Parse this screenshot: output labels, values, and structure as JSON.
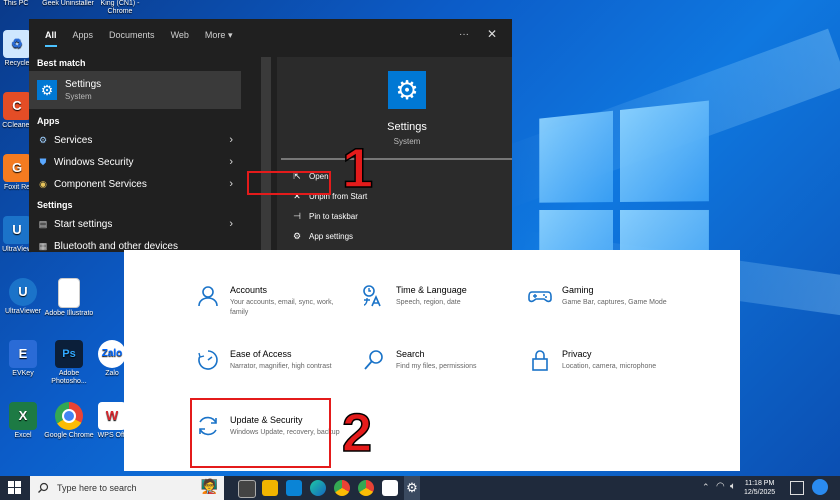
{
  "desktop": {
    "top_labels": [
      "This PC",
      "Geek Uninstaller",
      "King (CN1) - Chrome"
    ],
    "icons": [
      {
        "label": "Recycle",
        "color": "#9ad0ff",
        "glyph": "♻"
      },
      {
        "label": "CCleaner",
        "color": "#e44d26",
        "glyph": "C"
      },
      {
        "label": "Foxit Re",
        "color": "#f47b20",
        "glyph": "G"
      },
      {
        "label": "UltraView",
        "color": "#1b73c9",
        "glyph": "U"
      },
      {
        "label": "UltraViewer",
        "color": "#1b73c9",
        "glyph": "U"
      },
      {
        "label": "Adobe Illustrato",
        "color": "#ffffff",
        "glyph": ""
      },
      {
        "label": "EVKey",
        "color": "#2a6bd6",
        "glyph": "E"
      },
      {
        "label": "Adobe Photosho...",
        "color": "#0b1f3a",
        "glyph": "Ps"
      },
      {
        "label": "Zalo",
        "color": "#ffffff",
        "glyph": "Z"
      },
      {
        "label": "Excel",
        "color": "#1d7a44",
        "glyph": "X"
      },
      {
        "label": "Google Chrome",
        "color": "#ffffff",
        "glyph": ""
      },
      {
        "label": "WPS Offi",
        "color": "#ffffff",
        "glyph": "W"
      }
    ]
  },
  "start_menu": {
    "tabs": [
      "All",
      "Apps",
      "Documents",
      "Web",
      "More"
    ],
    "dots": "···",
    "close": "✕",
    "best_match_label": "Best match",
    "best_match": {
      "title": "Settings",
      "subtitle": "System"
    },
    "apps_label": "Apps",
    "apps": [
      {
        "label": "Services",
        "icon": "services-icon"
      },
      {
        "label": "Windows Security",
        "icon": "shield-icon"
      },
      {
        "label": "Component Services",
        "icon": "component-icon"
      }
    ],
    "settings_label": "Settings",
    "settings_items": [
      {
        "label": "Start settings",
        "icon": "start-settings-icon"
      },
      {
        "label": "Bluetooth and other devices",
        "icon": "bluetooth-icon"
      }
    ],
    "preview": {
      "title": "Settings",
      "subtitle": "System"
    },
    "actions": [
      {
        "label": "Open",
        "glyph": "⇱"
      },
      {
        "label": "Unpin from Start",
        "glyph": "✕"
      },
      {
        "label": "Pin to taskbar",
        "glyph": "⊣"
      },
      {
        "label": "App settings",
        "glyph": "⚙"
      }
    ]
  },
  "callouts": {
    "one": "1",
    "two": "2"
  },
  "settings": {
    "items": [
      {
        "title": "Accounts",
        "desc": "Your accounts, email, sync, work, family",
        "icon": "person-icon"
      },
      {
        "title": "Time & Language",
        "desc": "Speech, region, date",
        "icon": "time-language-icon"
      },
      {
        "title": "Gaming",
        "desc": "Game Bar, captures, Game Mode",
        "icon": "gamepad-icon"
      },
      {
        "title": "Ease of Access",
        "desc": "Narrator, magnifier, high contrast",
        "icon": "ease-of-access-icon"
      },
      {
        "title": "Search",
        "desc": "Find my files, permissions",
        "icon": "search-icon"
      },
      {
        "title": "Privacy",
        "desc": "Location, camera, microphone",
        "icon": "lock-icon"
      },
      {
        "title": "Update & Security",
        "desc": "Windows Update, recovery, backup",
        "icon": "update-icon"
      }
    ]
  },
  "taskbar": {
    "search_placeholder": "Type here to search",
    "time": "11:18 PM",
    "date": "12/5/2025"
  },
  "colors": {
    "accent": "#0078d4",
    "highlight": "#e41b1b",
    "icon_blue": "#1a73c8"
  }
}
